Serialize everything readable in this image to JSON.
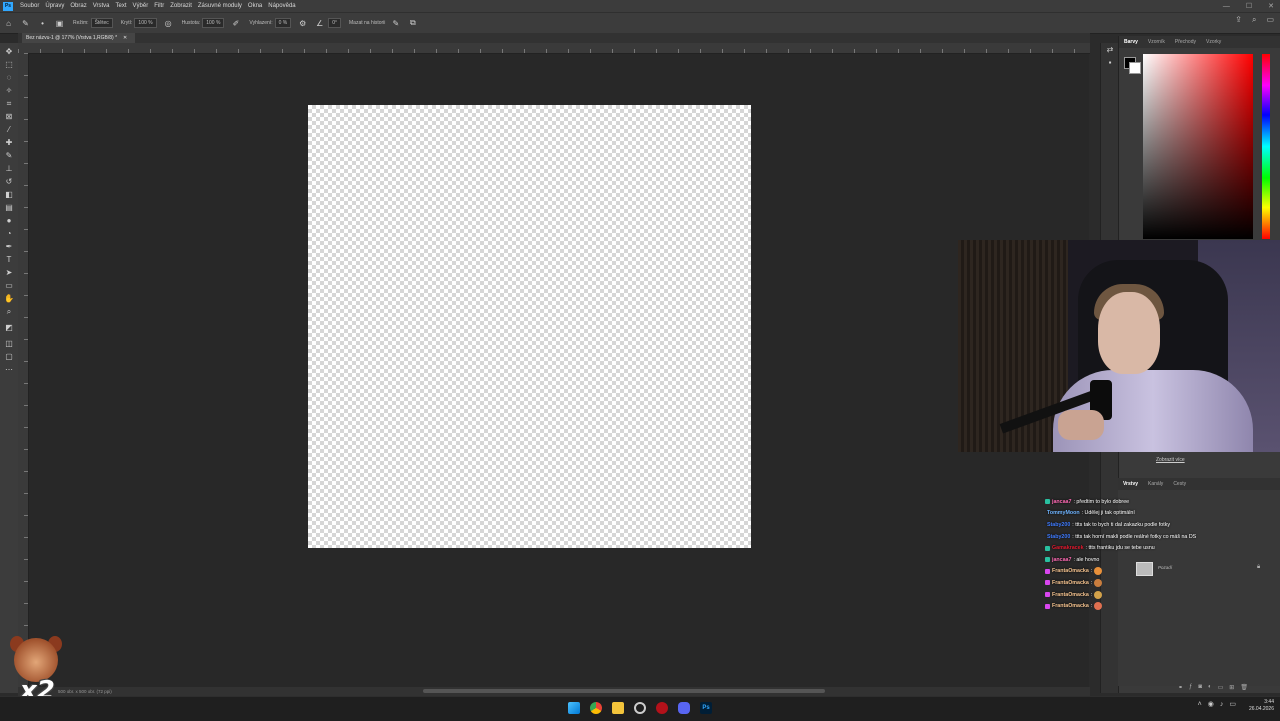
{
  "app": {
    "logo": "Ps",
    "menu": [
      "Soubor",
      "Úpravy",
      "Obraz",
      "Vrstva",
      "Text",
      "Výběr",
      "Filtr",
      "Zobrazit",
      "Zásuvné moduly",
      "Okna",
      "Nápověda"
    ]
  },
  "options": {
    "mode_label": "Režim:",
    "mode_value": "Štětec",
    "opacity_label": "Krytí:",
    "opacity_value": "100 %",
    "flow_label": "Hustota:",
    "flow_value": "100 %",
    "smoothing_label": "Vyhlazení:",
    "smoothing_value": "0 %",
    "angle_value": "0°",
    "erase_history_label": "Mazat na historii"
  },
  "document": {
    "tab_title": "Bez názvu-1 @ 177% (Vrstva 1,RGB/8) *",
    "status": "500 obr. x 500 obr. (72 ppi)"
  },
  "color_panel": {
    "tabs": [
      "Barvy",
      "Vzorník",
      "Přechody",
      "Vzorky"
    ],
    "active_tab": "Barvy",
    "foreground": "#000000",
    "background": "#ffffff"
  },
  "layers_panel": {
    "tabs": [
      "Vrstvy",
      "Kanály",
      "Cesty"
    ],
    "active_tab": "Vrstvy",
    "layer_name": "Pozadí",
    "webcam_caption": "Zobrazit více"
  },
  "chat": [
    {
      "name": "jancaa7",
      "name_color": "#ff69b4",
      "text": ": předtim to bylo dobree",
      "badge_color": "#29c0a0"
    },
    {
      "name": "TommyMoon",
      "name_color": "#6fb4ff",
      "text": ": Udělej ji tak optimální",
      "badge_color": ""
    },
    {
      "name": "Staby200",
      "name_color": "#3f7bff",
      "text": ": ttts tak to bych ti dal zakazku podle fotky",
      "badge_color": ""
    },
    {
      "name": "Staby200",
      "name_color": "#3f7bff",
      "text": ": ttts tak horní makli podle reálné fotky co máš na DS",
      "badge_color": ""
    },
    {
      "name": "Gamakracek",
      "name_color": "#e0182d",
      "text": ": ttts frantiku jdu se tebe usnu",
      "badge_color": "#29c0a0"
    },
    {
      "name": "jancaa7",
      "name_color": "#ff69b4",
      "text": ": ale hovno",
      "badge_color": "#29c0a0"
    },
    {
      "name": "FrantaOmacka",
      "name_color": "#f4c28e",
      "text": ":",
      "badge_color": "#d946ef"
    },
    {
      "name": "FrantaOmacka",
      "name_color": "#f4c28e",
      "text": ":",
      "badge_color": "#d946ef"
    },
    {
      "name": "FrantaOmacka",
      "name_color": "#f4c28e",
      "text": ":",
      "badge_color": "#d946ef"
    },
    {
      "name": "FrantaOmacka",
      "name_color": "#f4c28e",
      "text": ":",
      "badge_color": "#d946ef"
    }
  ],
  "mascot": {
    "text": "x2"
  },
  "taskbar": {
    "time": "3:44",
    "date": "26.04.2026"
  },
  "colors": {
    "accent": "#31a8ff",
    "canvas_bg": "#282828"
  }
}
